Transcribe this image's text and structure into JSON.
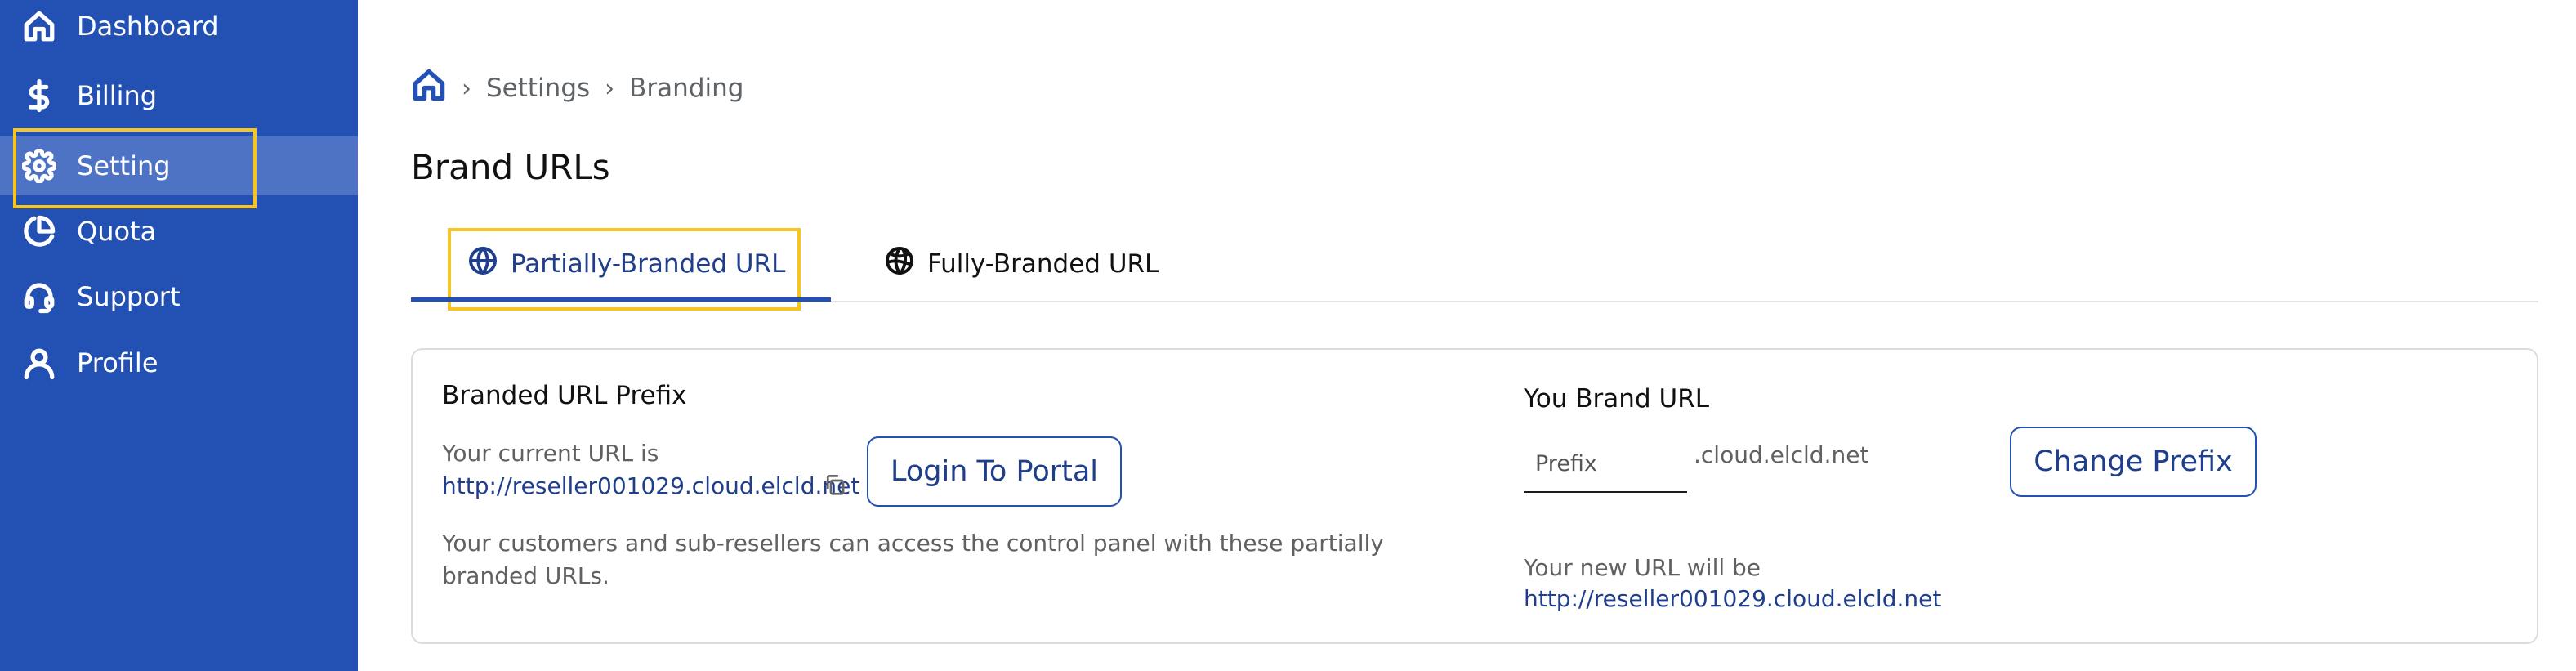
{
  "sidebar": {
    "items": [
      {
        "label": "Dashboard",
        "icon": "home-icon"
      },
      {
        "label": "Billing",
        "icon": "dollar-icon"
      },
      {
        "label": "Setting",
        "icon": "gear-icon",
        "active": true
      },
      {
        "label": "Quota",
        "icon": "pie-chart-icon"
      },
      {
        "label": "Support",
        "icon": "headset-icon"
      },
      {
        "label": "Profile",
        "icon": "user-icon"
      }
    ]
  },
  "breadcrumb": {
    "home_icon": "home-icon",
    "items": [
      "Settings",
      "Branding"
    ]
  },
  "page": {
    "title": "Brand URLs"
  },
  "tabs": [
    {
      "label": "Partially-Branded URL",
      "icon": "globe-icon",
      "active": true
    },
    {
      "label": "Fully-Branded URL",
      "icon": "globe-grid-icon",
      "active": false
    }
  ],
  "partial_card": {
    "heading": "Branded URL Prefix",
    "current_url_label": "Your current URL is",
    "current_url": "http://reseller001029.cloud.elcld.net",
    "login_button": "Login To Portal",
    "description_line1": "Your customers and sub-resellers can access the control panel with these partially",
    "description_line2": "branded URLs."
  },
  "brand_url": {
    "heading": "You Brand URL",
    "prefix_placeholder": "Prefix",
    "domain_suffix": ".cloud.elcld.net",
    "change_button": "Change Prefix",
    "new_url_label": "Your new URL will be",
    "new_url": "http://reseller001029.cloud.elcld.net"
  },
  "colors": {
    "sidebar_bg": "#2251b3",
    "sidebar_active_bg": "#4e73c4",
    "accent": "#1f3f8c",
    "highlight": "#f7c521"
  }
}
